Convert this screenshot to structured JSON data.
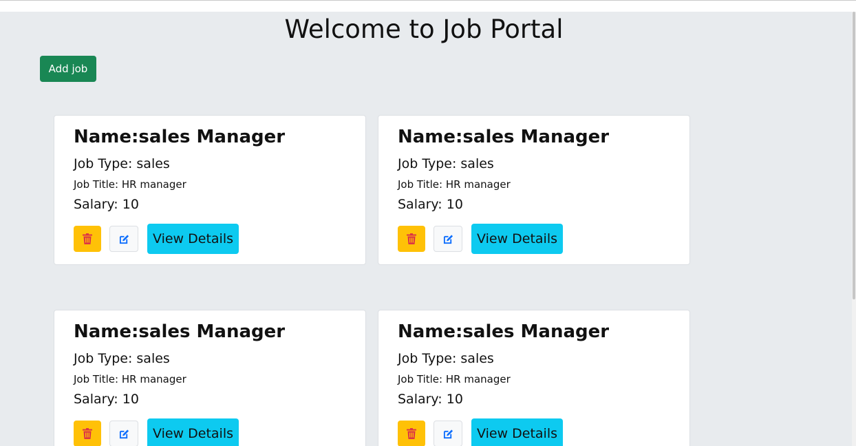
{
  "page": {
    "title": "Welcome to Job Portal",
    "add_button_label": "Add job"
  },
  "jobs": [
    {
      "name": "Name:sales Manager",
      "job_type": "Job Type: sales",
      "job_title": "Job Title: HR manager",
      "salary": "Salary: 10",
      "view_label": "View Details"
    },
    {
      "name": "Name:sales Manager",
      "job_type": "Job Type: sales",
      "job_title": "Job Title: HR manager",
      "salary": "Salary: 10",
      "view_label": "View Details"
    },
    {
      "name": "Name:sales Manager",
      "job_type": "Job Type: sales",
      "job_title": "Job Title: HR manager",
      "salary": "Salary: 10",
      "view_label": "View Details"
    },
    {
      "name": "Name:sales Manager",
      "job_type": "Job Type: sales",
      "job_title": "Job Title: HR manager",
      "salary": "Salary: 10",
      "view_label": "View Details"
    }
  ],
  "icons": {
    "delete": "trash-icon",
    "edit": "edit-icon"
  },
  "colors": {
    "background": "#e8ebee",
    "add_button": "#198754",
    "delete_button": "#ffc107",
    "delete_icon": "#dc3545",
    "edit_icon": "#0d6efd",
    "view_button": "#0dcaf0"
  }
}
